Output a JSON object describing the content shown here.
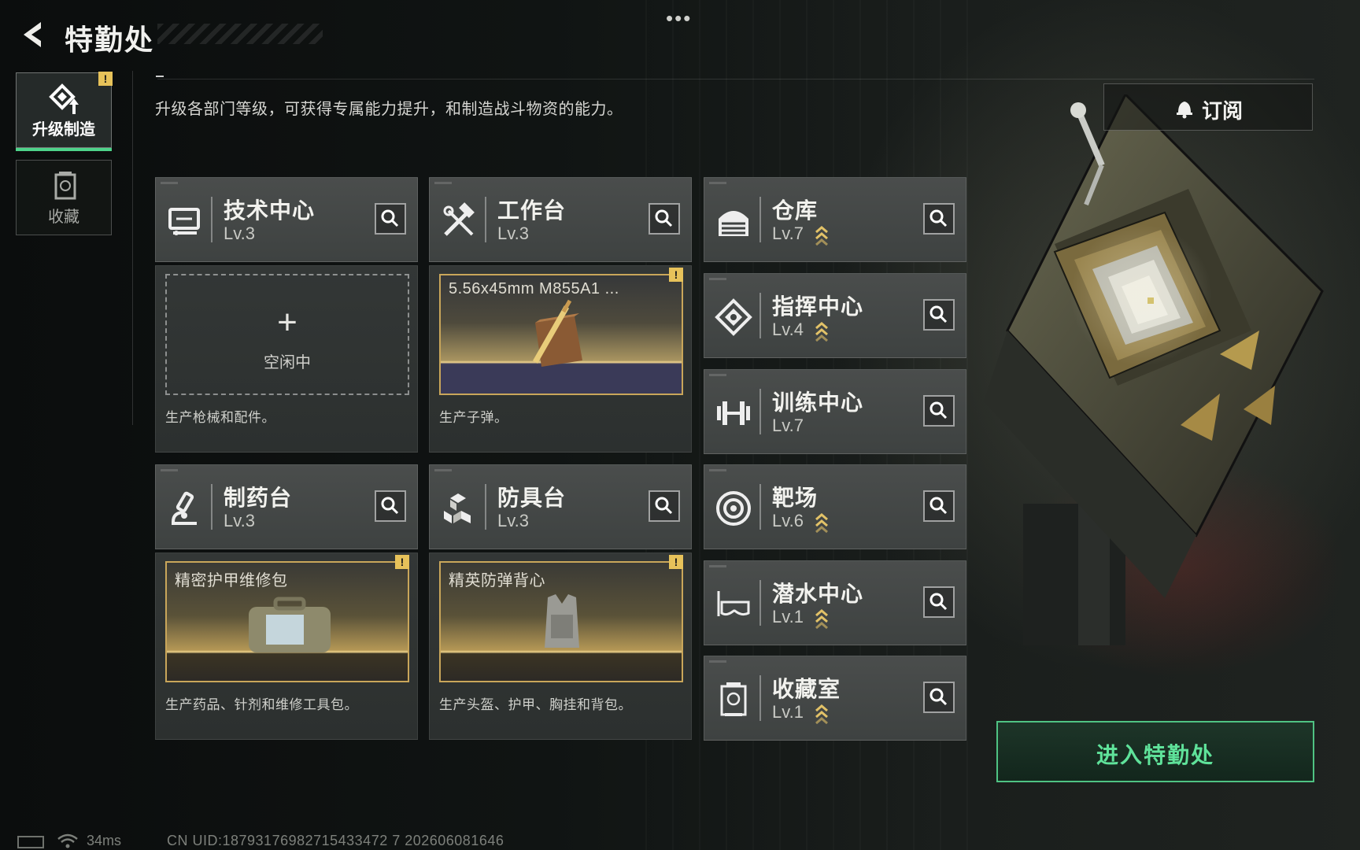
{
  "header": {
    "title": "特勤处",
    "menu_dots": "•••"
  },
  "description": "升级各部门等级，可获得专属能力提升，和制造战斗物资的能力。",
  "sidebar": {
    "items": [
      {
        "label": "升级制造",
        "active": true,
        "alert": "!",
        "icon": "upgrade-icon"
      },
      {
        "label": "收藏",
        "active": false,
        "icon": "collection-icon"
      }
    ]
  },
  "subscribe": {
    "label": "订阅",
    "icon": "bell-icon"
  },
  "workshops": [
    {
      "name": "技术中心",
      "level": "Lv.3",
      "icon": "tech-center-icon",
      "slot": {
        "state": "idle",
        "plus": "+",
        "label": "空闲中"
      },
      "desc": "生产枪械和配件。"
    },
    {
      "name": "工作台",
      "level": "Lv.3",
      "icon": "workbench-icon",
      "slot": {
        "state": "producing",
        "item": "5.56x45mm M855A1 ...",
        "alert": "!"
      },
      "desc": "生产子弹。"
    },
    {
      "name": "制药台",
      "level": "Lv.3",
      "icon": "pharmacy-icon",
      "slot": {
        "state": "producing",
        "item": "精密护甲维修包",
        "alert": "!"
      },
      "desc": "生产药品、针剂和维修工具包。"
    },
    {
      "name": "防具台",
      "level": "Lv.3",
      "icon": "armor-bench-icon",
      "slot": {
        "state": "producing",
        "item": "精英防弹背心",
        "alert": "!"
      },
      "desc": "生产头盔、护甲、胸挂和背包。"
    }
  ],
  "facilities": [
    {
      "name": "仓库",
      "level": "Lv.7",
      "upgradable": true,
      "icon": "warehouse-icon"
    },
    {
      "name": "指挥中心",
      "level": "Lv.4",
      "upgradable": true,
      "icon": "command-center-icon"
    },
    {
      "name": "训练中心",
      "level": "Lv.7",
      "upgradable": false,
      "icon": "dumbbell-icon"
    },
    {
      "name": "靶场",
      "level": "Lv.6",
      "upgradable": true,
      "icon": "target-icon"
    },
    {
      "name": "潜水中心",
      "level": "Lv.1",
      "upgradable": true,
      "icon": "diving-mask-icon"
    },
    {
      "name": "收藏室",
      "level": "Lv.1",
      "upgradable": true,
      "icon": "collection-room-icon"
    }
  ],
  "enter_button": {
    "label": "进入特勤处"
  },
  "footer": {
    "ping": "34ms",
    "uid": "CN UID:18793176982715433472 7 202606081646"
  },
  "colors": {
    "accent_green": "#4fc383",
    "alert_yellow": "#e7c25a",
    "gold": "#c9a65a"
  }
}
